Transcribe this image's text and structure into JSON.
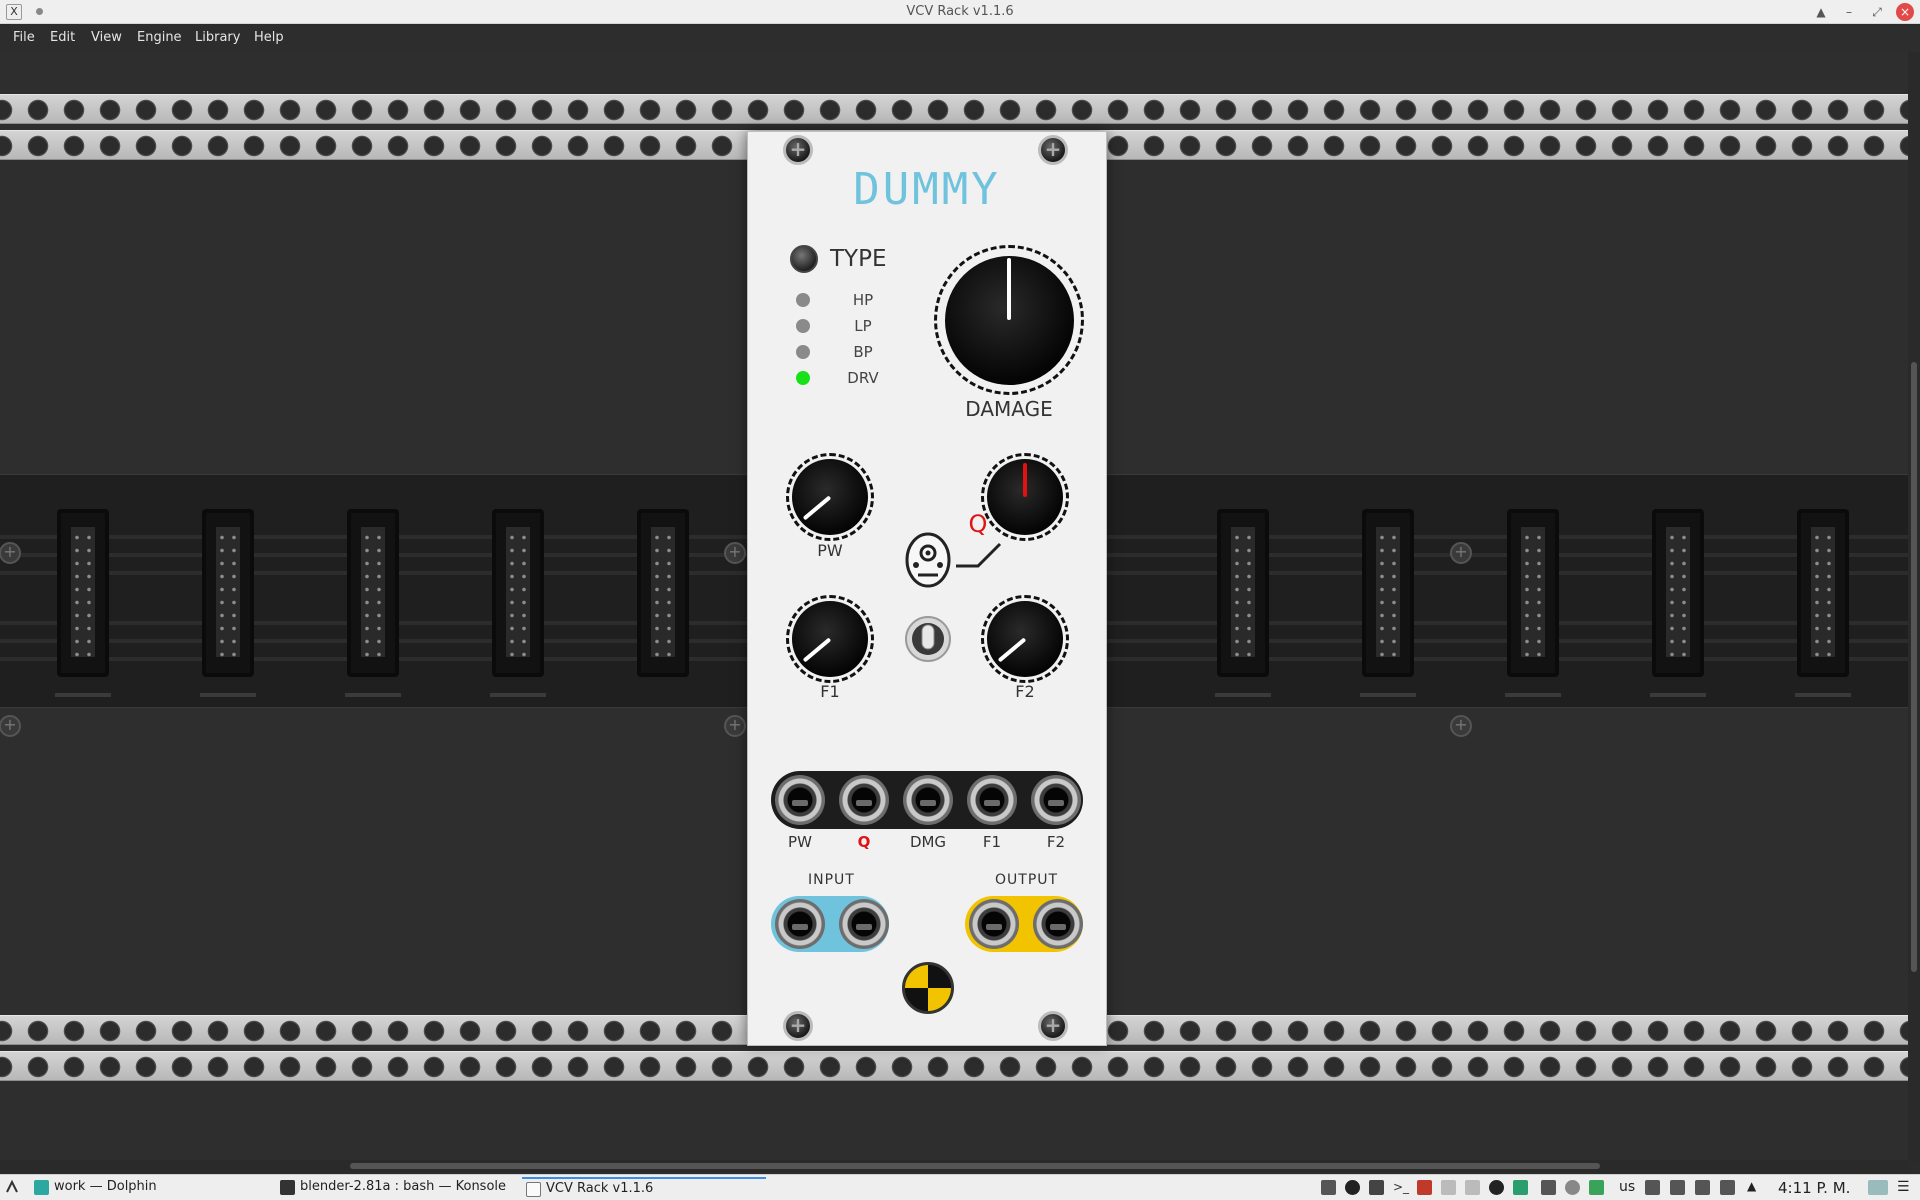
{
  "window": {
    "title": "VCV Rack v1.1.6",
    "app_icon": "X"
  },
  "menu": {
    "items": [
      "File",
      "Edit",
      "View",
      "Engine",
      "Library",
      "Help"
    ]
  },
  "module": {
    "title": "DUMMY",
    "type_label": "TYPE",
    "modes": [
      {
        "label": "HP",
        "active": false
      },
      {
        "label": "LP",
        "active": false
      },
      {
        "label": "BP",
        "active": false
      },
      {
        "label": "DRV",
        "active": true
      }
    ],
    "knobs": {
      "damage": {
        "label": "DAMAGE"
      },
      "pw": {
        "label": "PW"
      },
      "q": {
        "label": "Q"
      },
      "f1": {
        "label": "F1"
      },
      "f2": {
        "label": "F2"
      }
    },
    "cv_inputs": [
      "PW",
      "Q",
      "DMG",
      "F1",
      "F2"
    ],
    "input_label": "INPUT",
    "output_label": "OUTPUT",
    "colors": {
      "title": "#6fc3dd",
      "input_pill": "#6fc3dd",
      "output_pill": "#f2c400",
      "q_accent": "#e01212",
      "led_on": "#19e119"
    }
  },
  "taskbar": {
    "tasks": [
      {
        "label": "work — Dolphin",
        "icon": "folder-icon"
      },
      {
        "label": "blender-2.81a : bash — Konsole",
        "icon": "terminal-icon"
      },
      {
        "label": "VCV Rack v1.1.6",
        "icon": "x-window-icon"
      }
    ],
    "keyboard_layout": "us",
    "clock": "4:11 P. M."
  }
}
